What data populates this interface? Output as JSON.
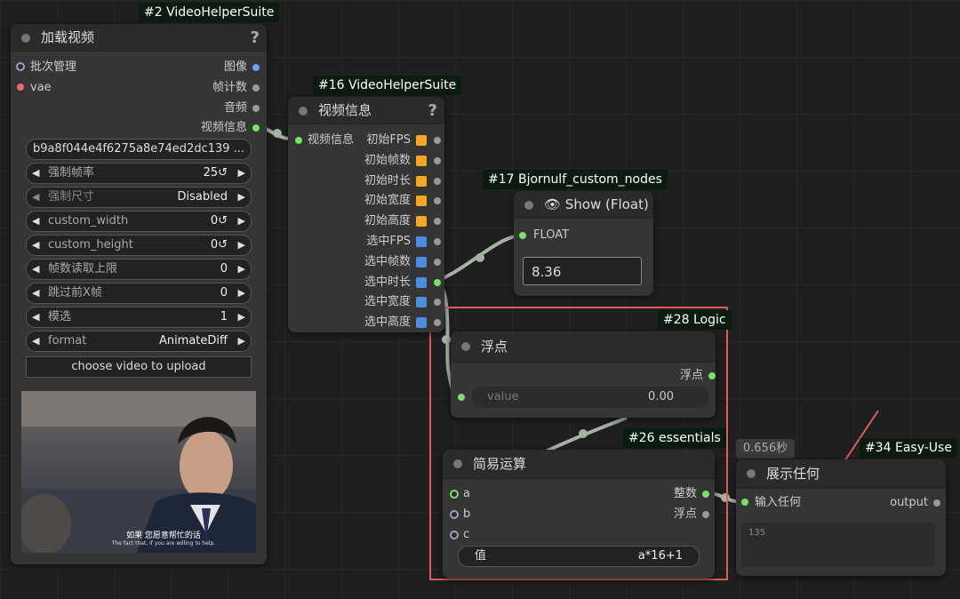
{
  "colors": {
    "accent_green": "#7dde6e",
    "slot_blue": "#6aa4e8",
    "slot_orange": "#f5a623",
    "highlight_red": "#e05a5a",
    "badge_bg": "#0a1c10"
  },
  "load_video": {
    "badge": "#2 VideoHelperSuite",
    "title": "加载视频",
    "help": "?",
    "inputs": [
      "批次管理",
      "vae"
    ],
    "outputs": [
      "图像",
      "帧计数",
      "音频",
      "视频信息"
    ],
    "file": "b9a8f044e4f6275a8e74ed2dc139 ...",
    "widgets": [
      {
        "label": "强制帧率",
        "value": "25↺"
      },
      {
        "label": "强制尺寸",
        "value": "Disabled"
      },
      {
        "label": "custom_width",
        "value": "0↺"
      },
      {
        "label": "custom_height",
        "value": "0↺"
      },
      {
        "label": "帧数读取上限",
        "value": "0"
      },
      {
        "label": "跳过前X帧",
        "value": "0"
      },
      {
        "label": "模选",
        "value": "1"
      },
      {
        "label": "format",
        "value": "AnimateDiff"
      }
    ],
    "upload_button": "choose video to upload",
    "subtitle_line1": "如果 您愿意帮忙的话",
    "subtitle_line2": "The fact that, if you are willing to help."
  },
  "video_info": {
    "badge": "#16 VideoHelperSuite",
    "title": "视频信息",
    "help": "?",
    "input": "视频信息",
    "outputs": [
      "初始FPS",
      "初始帧数",
      "初始时长",
      "初始宽度",
      "初始高度",
      "选中FPS",
      "选中帧数",
      "选中时长",
      "选中宽度",
      "选中高度"
    ]
  },
  "show_float": {
    "badge": "#17 Bjornulf_custom_nodes",
    "title": "👁 Show (Float)",
    "input": "FLOAT",
    "value": "8.36"
  },
  "logic": {
    "badge": "#28 Logic",
    "title": "浮点",
    "output": "浮点",
    "widget_label": "value",
    "widget_value": "0.00"
  },
  "simple_math": {
    "badge": "#26 essentials",
    "title": "简易运算",
    "inputs": [
      "a",
      "b",
      "c"
    ],
    "outputs": [
      "整数",
      "浮点"
    ],
    "widget_label": "值",
    "widget_value": "a*16+1"
  },
  "show_any": {
    "timer": "0.656秒",
    "badge": "#34 Easy-Use",
    "title": "展示任何",
    "input": "输入任何",
    "output": "output",
    "value": "135"
  }
}
